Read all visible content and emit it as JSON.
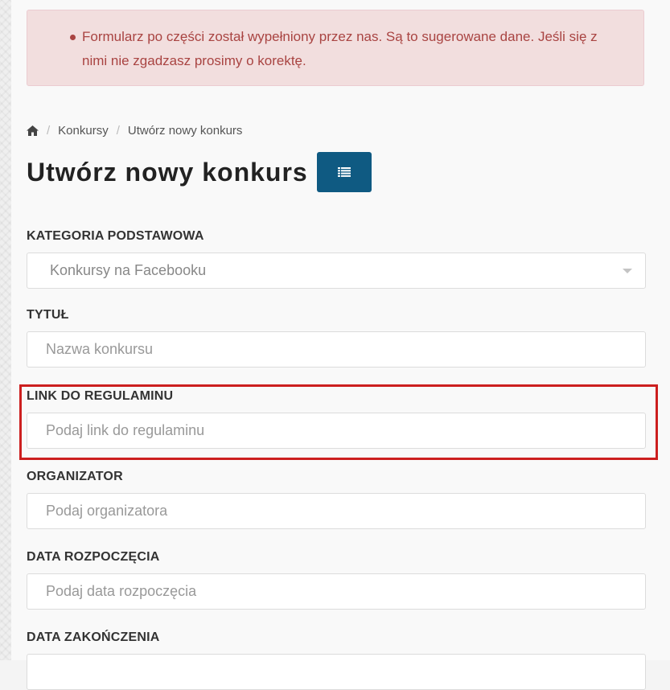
{
  "alert": {
    "message": "Formularz po części został wypełniony przez nas. Są to sugerowane dane. Jeśli się z nimi nie zgadzasz prosimy o korektę."
  },
  "breadcrumb": {
    "home_icon": "home-icon",
    "items": [
      "Konkursy",
      "Utwórz nowy konkurs"
    ]
  },
  "page": {
    "title": "Utwórz nowy konkurs",
    "list_button_icon": "list-icon"
  },
  "form": {
    "category": {
      "label": "KATEGORIA PODSTAWOWA",
      "selected": "Konkursy na Facebooku"
    },
    "title": {
      "label": "TYTUŁ",
      "placeholder": "Nazwa konkursu"
    },
    "rules_link": {
      "label": "LINK DO REGULAMINU",
      "placeholder": "Podaj link do regulaminu"
    },
    "organizer": {
      "label": "ORGANIZATOR",
      "placeholder": "Podaj organizatora"
    },
    "start_date": {
      "label": "DATA ROZPOCZĘCIA",
      "placeholder": "Podaj data rozpoczęcia"
    },
    "end_date": {
      "label": "DATA ZAKOŃCZENIA"
    }
  },
  "colors": {
    "alert_bg": "#f2dede",
    "alert_text": "#a94442",
    "primary_button": "#0f5a82",
    "highlight_border": "#cc1f1f"
  }
}
